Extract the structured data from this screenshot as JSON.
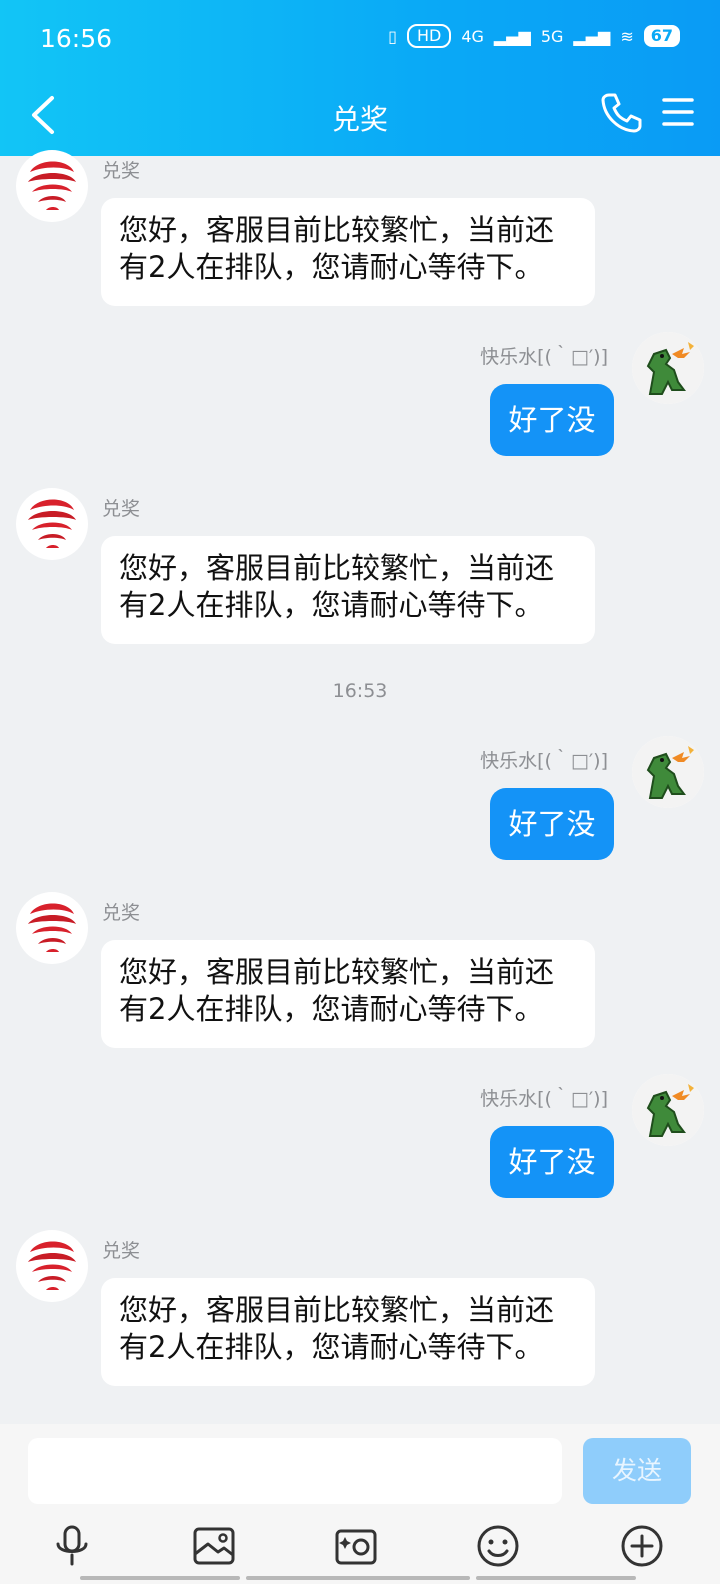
{
  "status_bar": {
    "time": "16:56",
    "hd": "HD",
    "net_4g": "4G",
    "net_5g": "5G",
    "battery": "67"
  },
  "nav": {
    "title": "兑奖"
  },
  "messages": [
    {
      "side": "in",
      "sender": "兑奖",
      "text": "您好，客服目前比较繁忙，当前还有2人在排队，您请耐心等待下。"
    },
    {
      "side": "out",
      "sender": "快乐水[(｀□′)]",
      "text": "好了没"
    },
    {
      "side": "in",
      "sender": "兑奖",
      "text": "您好，客服目前比较繁忙，当前还有2人在排队，您请耐心等待下。"
    },
    {
      "side": "time",
      "text": "16:53"
    },
    {
      "side": "out",
      "sender": "快乐水[(｀□′)]",
      "text": "好了没"
    },
    {
      "side": "in",
      "sender": "兑奖",
      "text": "您好，客服目前比较繁忙，当前还有2人在排队，您请耐心等待下。"
    },
    {
      "side": "out",
      "sender": "快乐水[(｀□′)]",
      "text": "好了没"
    },
    {
      "side": "in",
      "sender": "兑奖",
      "text": "您好，客服目前比较繁忙，当前还有2人在排队，您请耐心等待下。"
    }
  ],
  "composer": {
    "input_value": "",
    "input_placeholder": "",
    "send_label": "发送"
  },
  "toolbar": [
    "microphone-icon",
    "image-icon",
    "camera-icon",
    "emoji-icon",
    "plus-icon"
  ],
  "colors": {
    "header_start": "#12c5f6",
    "header_end": "#0a9bf5",
    "outgoing_bubble": "#1493f7",
    "send_disabled": "#8fcdfb",
    "background": "#eff1f3"
  }
}
